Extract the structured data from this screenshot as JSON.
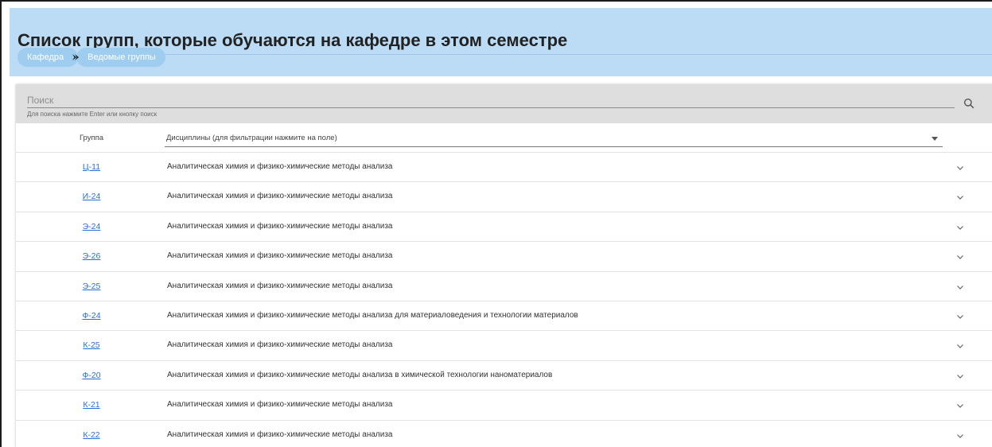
{
  "page": {
    "title": "Список групп, которые обучаются на кафедре в этом семестре",
    "breadcrumbs": [
      "Кафедра",
      "Ведомые группы"
    ]
  },
  "search": {
    "placeholder": "Поиск",
    "hint": "Для поиска нажмите Enter или кнопку поиск",
    "icon": "search-icon"
  },
  "table": {
    "columns": {
      "group": "Группа",
      "disciplines_filter": "Дисциплины (для фильтрации нажмите на поле)"
    },
    "rows": [
      {
        "group": "Ц-11",
        "discipline": "Аналитическая химия и физико-химические методы анализа"
      },
      {
        "group": "И-24",
        "discipline": "Аналитическая химия и физико-химические методы анализа"
      },
      {
        "group": "Э-24",
        "discipline": "Аналитическая химия и физико-химические методы анализа"
      },
      {
        "group": "Э-26",
        "discipline": "Аналитическая химия и физико-химические методы анализа"
      },
      {
        "group": "Э-25",
        "discipline": "Аналитическая химия и физико-химические методы анализа"
      },
      {
        "group": "Ф-24",
        "discipline": "Аналитическая химия и физико-химические методы анализа для материаловедения и технологии материалов"
      },
      {
        "group": "К-25",
        "discipline": "Аналитическая химия и физико-химические методы анализа"
      },
      {
        "group": "Ф-20",
        "discipline": "Аналитическая химия и физико-химические методы анализа в химической технологии наноматериалов"
      },
      {
        "group": "К-21",
        "discipline": "Аналитическая химия и физико-химические методы анализа"
      },
      {
        "group": "К-22",
        "discipline": "Аналитическая химия и физико-химические методы анализа"
      }
    ]
  },
  "colors": {
    "header_bg": "#bcdcf5",
    "breadcrumb_bg": "#9fcdf0",
    "link": "#2a6fd6",
    "search_bg": "#dedede"
  }
}
